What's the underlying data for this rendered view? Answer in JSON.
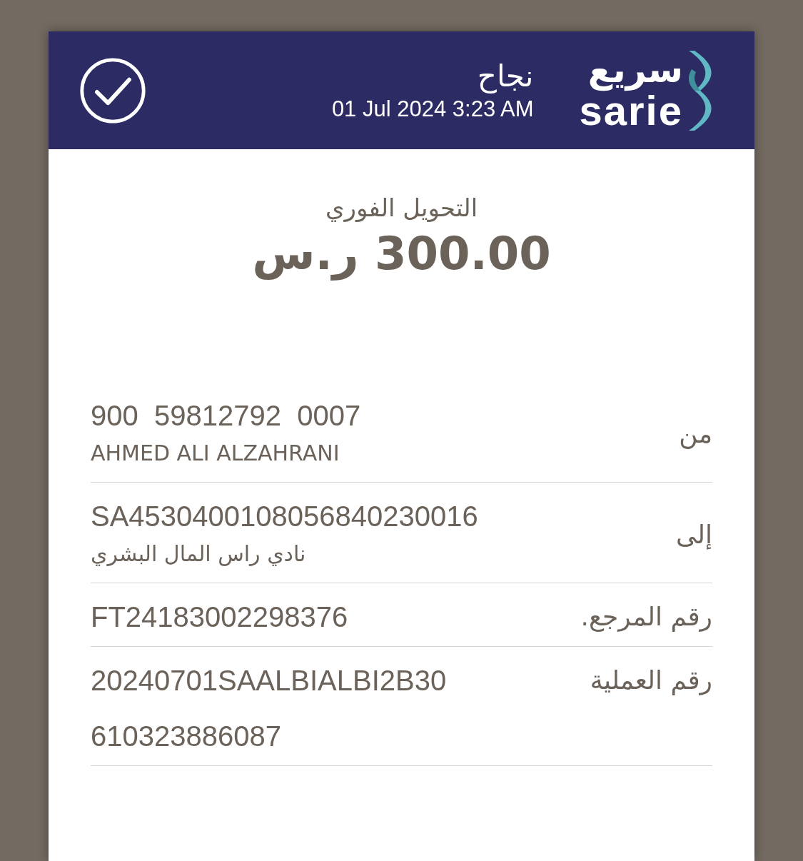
{
  "header": {
    "logo": {
      "arabic": "سريع",
      "latin": "sarie"
    },
    "status": "نجاح",
    "datetime": "01 Jul 2024 3:23 AM"
  },
  "transfer": {
    "title": "التحويل الفوري",
    "amount": "300.00 ر.س"
  },
  "details": [
    {
      "label": "من",
      "value_lines": [
        "900  59812792  0007"
      ],
      "sub": "AHMED ALI ALZAHRANI"
    },
    {
      "label": "إلى",
      "value_lines": [
        "SA4530400108056840230016"
      ],
      "sub": "نادي راس المال البشري"
    },
    {
      "label": "رقم المرجع.",
      "value_lines": [
        "FT24183002298376"
      ]
    },
    {
      "label": "رقم العملية",
      "value_lines": [
        "20240701SAALBIALBI2B30",
        "610323886087"
      ]
    }
  ]
}
